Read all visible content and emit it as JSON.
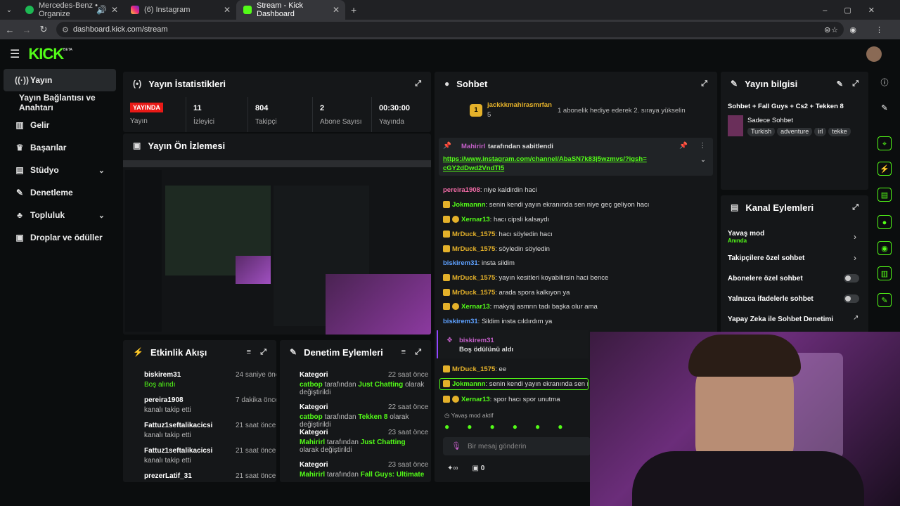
{
  "browser": {
    "tabs": [
      {
        "title": "Mercedes-Benz • Organize"
      },
      {
        "title": "(6) Instagram"
      },
      {
        "title": "Stream - Kick Dashboard"
      }
    ],
    "url": "dashboard.kick.com/stream"
  },
  "brand": {
    "logo": "KICK",
    "beta": "BETA"
  },
  "sidebar": {
    "items": [
      {
        "label": "Yayın"
      },
      {
        "label": "Yayın Bağlantısı ve Anahtarı"
      },
      {
        "label": "Gelir"
      },
      {
        "label": "Başarılar"
      },
      {
        "label": "Stüdyo"
      },
      {
        "label": "Denetleme"
      },
      {
        "label": "Topluluk"
      },
      {
        "label": "Droplar ve ödüller"
      }
    ]
  },
  "stats": {
    "title": "Yayın İstatistikleri",
    "live_badge": "YAYINDA",
    "items": [
      {
        "value": "",
        "label": "Yayın"
      },
      {
        "value": "11",
        "label": "İzleyici"
      },
      {
        "value": "804",
        "label": "Takipçi"
      },
      {
        "value": "2",
        "label": "Abone Sayısı"
      },
      {
        "value": "00:30:00",
        "label": "Yayında"
      }
    ]
  },
  "preview": {
    "title": "Yayın Ön İzlemesi"
  },
  "activity": {
    "title": "Etkinlik Akışı",
    "events": [
      {
        "name": "biskirem31",
        "desc": "Boş alındı",
        "time": "24 saniye önce"
      },
      {
        "name": "pereira1908",
        "desc": "kanalı takip etti",
        "time": "7 dakika önce"
      },
      {
        "name": "Fattuz1seftalikacicsi",
        "desc": "kanalı takip etti",
        "time": "21 saat önce"
      },
      {
        "name": "Fattuz1seftalikacicsi",
        "desc": "kanalı takip etti",
        "time": "21 saat önce"
      },
      {
        "name": "prezerLatif_31",
        "desc": "",
        "time": "21 saat önce"
      }
    ]
  },
  "moderation": {
    "title": "Denetim Eylemleri",
    "events": [
      {
        "name": "Kategori",
        "user": "catbop",
        "desc": "tarafından",
        "cat": "Just Chatting",
        "tail": "olarak değiştirildi",
        "time": "22 saat önce"
      },
      {
        "name": "Kategori",
        "user": "catbop",
        "desc": "tarafından",
        "cat": "Tekken 8",
        "tail": "olarak değiştirildi",
        "time": "22 saat önce"
      },
      {
        "name": "Kategori",
        "user": "Mahirirl",
        "desc": "tarafından",
        "cat": "Just Chatting",
        "tail": "olarak değiştirildi",
        "time": "23 saat önce"
      },
      {
        "name": "Kategori",
        "user": "Mahirirl",
        "desc": "tarafından",
        "cat": "Fall Guys: Ultimate",
        "tail": "",
        "time": "23 saat önce"
      }
    ]
  },
  "chat": {
    "title": "Sohbet",
    "gifter": "jackkkmahirasmrfan",
    "gifter_count": "5",
    "gift_text": "1 abonelik hediye ederek 2. sıraya yükselin",
    "pinned_by": "Mahirirl",
    "pinned_label": "tarafından sabitlendi",
    "pinned_link": "https://www.instagram.com/channel/AbaSN7k83j5wzmvs/?igsh=cGY2dDwd2VndTI5",
    "messages": [
      {
        "user": "pereira1908",
        "text": "niye kaldirdin haci",
        "color": "#f06ba6"
      },
      {
        "user": "Jokmannn",
        "text": "senin kendi yayın ekranında sen niye geç geliyon hacı",
        "color": "#53fc18"
      },
      {
        "user": "Xernar13",
        "text": "hacı cipsli kalsaydı",
        "color": "#53fc18"
      },
      {
        "user": "MrDuck_1575",
        "text": "hacı söyledin hacı",
        "color": "#e4b12a"
      },
      {
        "user": "MrDuck_1575",
        "text": "söyledin söyledin",
        "color": "#e4b12a"
      },
      {
        "user": "biskirem31",
        "text": "insta sildim",
        "color": "#5ea1ff"
      },
      {
        "user": "MrDuck_1575",
        "text": "yayın kesitleri koyabilirsin haci bence",
        "color": "#e4b12a"
      },
      {
        "user": "MrDuck_1575",
        "text": "arada spora kalkıyon ya",
        "color": "#e4b12a"
      },
      {
        "user": "Xernar13",
        "text": "makyaj asmrın tadı başka olur ama",
        "color": "#53fc18"
      },
      {
        "user": "biskirem31",
        "text": "Sildim insta cıldırdım ya",
        "color": "#5ea1ff"
      },
      {
        "user": "MrDuck_1575",
        "text": "ee",
        "color": "#e4b12a"
      },
      {
        "user": "Jokmannn",
        "text": "senin kendi yayın ekranında sen niy",
        "color": "#53fc18"
      },
      {
        "user": "Xernar13",
        "text": "spor hacı spor unutma",
        "color": "#53fc18"
      }
    ],
    "reward_user": "biskirem31",
    "reward_text": "Boş ödülünü aldı",
    "slow_mode": "Yavaş mod aktif",
    "input_placeholder": "Bir mesaj gönderin",
    "points": "0"
  },
  "info": {
    "title": "Yayın bilgisi",
    "stream_title": "Sohbet + Fall Guys + Cs2 + Tekken 8",
    "category": "Sadece Sohbet",
    "tags": [
      "Turkish",
      "adventure",
      "irl",
      "tekke"
    ]
  },
  "actions": {
    "title": "Kanal Eylemleri",
    "items": [
      {
        "label": "Yavaş mod",
        "sub": "Anında"
      },
      {
        "label": "Takipçilere özel sohbet"
      },
      {
        "label": "Abonelere özel sohbet"
      },
      {
        "label": "Yalnızca ifadelerle sohbet"
      },
      {
        "label": "Yapay Zeka ile Sohbet Denetimi"
      }
    ]
  },
  "colors": {
    "accent": "#53fc18",
    "panel": "#151719",
    "live": "#e91916"
  }
}
